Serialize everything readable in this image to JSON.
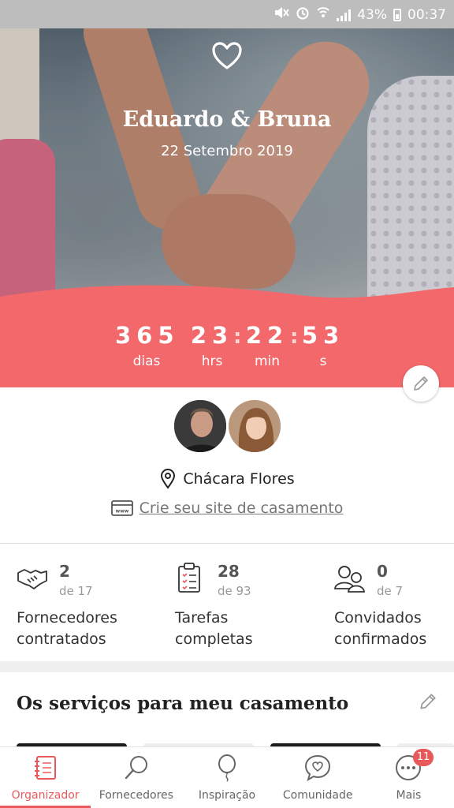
{
  "status_bar": {
    "battery_percent": "43%",
    "time": "00:37",
    "icons": [
      "mute-icon",
      "alarm-icon",
      "wifi-calling-icon",
      "signal-icon",
      "battery-icon"
    ]
  },
  "hero": {
    "icon": "heart-icon",
    "couple_name": "Eduardo & Bruna",
    "wedding_date": "22 Setembro 2019"
  },
  "countdown": {
    "days": "365",
    "days_label": "dias",
    "hours": "23",
    "hours_label": "hrs",
    "minutes": "22",
    "minutes_label": "min",
    "seconds": "53",
    "seconds_label": "s",
    "accent_color": "#f2686b"
  },
  "profile": {
    "venue": "Chácara Flores",
    "site_link": "Crie seu site de casamento"
  },
  "stats": [
    {
      "count": "2",
      "total": "de 17",
      "label_line1": "Fornecedores",
      "label_line2": "contratados",
      "icon": "handshake-icon"
    },
    {
      "count": "28",
      "total": "de 93",
      "label_line1": "Tarefas",
      "label_line2": "completas",
      "icon": "clipboard-checklist-icon"
    },
    {
      "count": "0",
      "total": "de 7",
      "label_line1": "Convidados",
      "label_line2": "confirmados",
      "icon": "guests-icon"
    }
  ],
  "services": {
    "title": "Os serviços para meu casamento"
  },
  "bottom_nav": {
    "items": [
      {
        "label": "Organizador",
        "icon": "notebook-icon",
        "active": true
      },
      {
        "label": "Fornecedores",
        "icon": "search-icon",
        "active": false
      },
      {
        "label": "Inspiração",
        "icon": "balloon-icon",
        "active": false
      },
      {
        "label": "Comunidade",
        "icon": "chat-heart-icon",
        "active": false
      },
      {
        "label": "Mais",
        "icon": "more-icon",
        "active": false,
        "badge": "11"
      }
    ],
    "active_color": "#e8595c"
  }
}
